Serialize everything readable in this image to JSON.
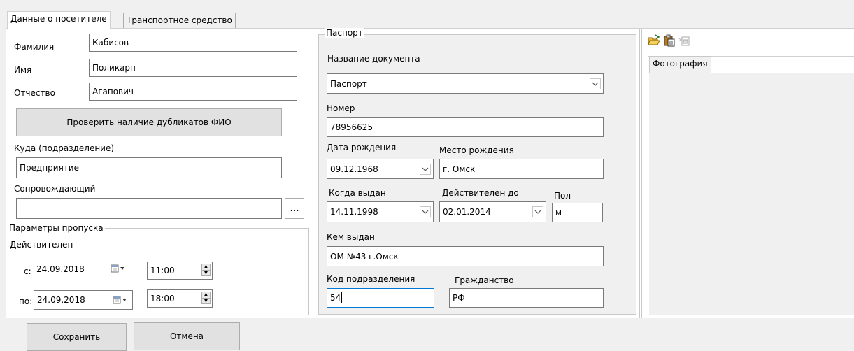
{
  "tabs": {
    "visitor": "Данные о посетителе",
    "vehicle": "Транспортное средство"
  },
  "visitor": {
    "last_name_label": "Фамилия",
    "last_name": "Кабисов",
    "first_name_label": "Имя",
    "first_name": "Поликарп",
    "patronymic_label": "Отчество",
    "patronymic": "Агапович",
    "check_duplicates": "Проверить наличие дубликатов ФИО",
    "destination_label": "Куда (подразделение)",
    "destination": "Предприятие",
    "escort_label": "Сопровождающий",
    "escort": "",
    "escort_browse": "..."
  },
  "pass": {
    "group_title": "Параметры пропуска",
    "valid_label": "Действителен",
    "from_label": "с:",
    "from_date": "24.09.2018",
    "from_time": "11:00",
    "to_label": "по:",
    "to_date": "24.09.2018",
    "to_time": "18:00"
  },
  "passport": {
    "group_title": "Паспорт",
    "doc_name_label": "Название документа",
    "doc_name": "Паспорт",
    "number_label": "Номер",
    "number": "78956625",
    "birth_date_label": "Дата рождения",
    "birth_date": "09.12.1968",
    "birth_place_label": "Место рождения",
    "birth_place": "г. Омск",
    "issued_label": "Когда выдан",
    "issued": "14.11.1998",
    "valid_until_label": "Действителен до",
    "valid_until": "02.01.2014",
    "sex_label": "Пол",
    "sex": "м",
    "issued_by_label": "Кем выдан",
    "issued_by": "ОМ №43 г.Омск",
    "dept_code_label": "Код подразделения",
    "dept_code": "54",
    "citizenship_label": "Гражданство",
    "citizenship": "РФ"
  },
  "photo": {
    "tab_label": "Фотография",
    "toolbar_icons": [
      "open-folder-icon",
      "paste-icon",
      "clear-image-icon"
    ]
  },
  "footer": {
    "save": "Сохранить",
    "cancel": "Отмена"
  }
}
